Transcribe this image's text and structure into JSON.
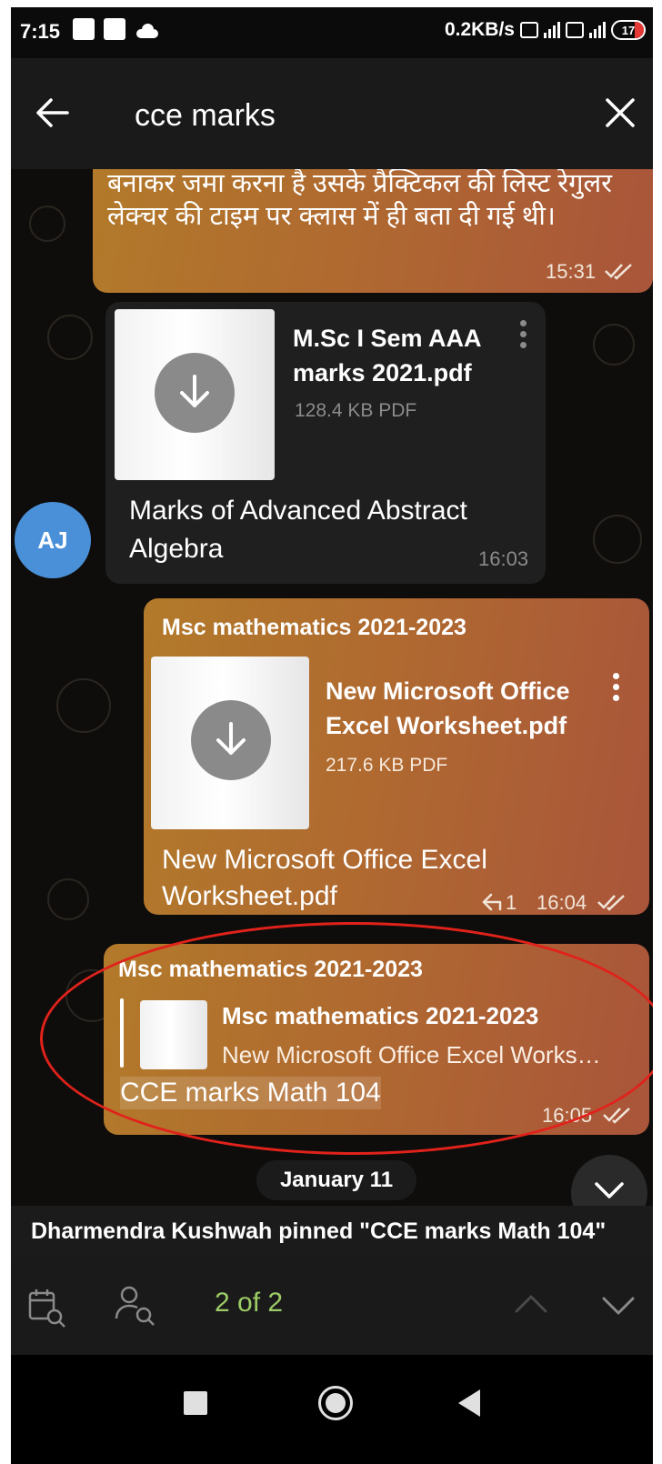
{
  "status_bar": {
    "time": "7:15",
    "speed": "0.2KB/s",
    "battery": "17",
    "net1": "Vo LTE",
    "net2": "Vo LTE",
    "net3": "4G"
  },
  "search": {
    "query": "cce marks",
    "icons": [
      "arrow-left-icon",
      "close-icon"
    ]
  },
  "messages": {
    "m1": {
      "text": "बनाकर जमा करना है उसके प्रैक्टिकल की लिस्ट रेगुलर लेक्चर की टाइम पर क्लास में ही बता दी गई थी।",
      "time": "15:31"
    },
    "m2": {
      "file_name_1": "M.Sc I Sem AAA",
      "file_name_2": "marks 2021.pdf",
      "file_size": "128.4 KB PDF",
      "caption_1": "Marks of Advanced Abstract",
      "caption_2": "Algebra",
      "time": "16:03",
      "avatar": "AJ"
    },
    "m3": {
      "sender": "Msc mathematics 2021-2023",
      "file_name_1": "New Microsoft Office",
      "file_name_2": "Excel Worksheet.pdf",
      "file_size": "217.6 KB PDF",
      "caption_1": "New Microsoft Office Excel",
      "caption_2": "Worksheet.pdf",
      "replies": "1",
      "time": "16:04"
    },
    "m4": {
      "sender": "Msc mathematics 2021-2023",
      "reply_title": "Msc mathematics 2021-2023",
      "reply_text": "New Microsoft Office Excel Works…",
      "text": "CCE marks Math 104",
      "time": "16:05"
    }
  },
  "date_chip": "January 11",
  "pinned_notice": "Dharmendra Kushwah pinned \"CCE marks Math 104\"",
  "toolbar": {
    "counter": "2 of 2",
    "icons": [
      "calendar-search-icon",
      "user-search-icon",
      "chevron-up-icon",
      "chevron-down-icon"
    ]
  },
  "colors": {
    "outgoing_bubble": "#b06a30",
    "incoming_bubble": "#1f1f1f",
    "counter": "#9ccc65",
    "highlight_ellipse": "#e0221b",
    "avatar": "#4a90d9"
  }
}
